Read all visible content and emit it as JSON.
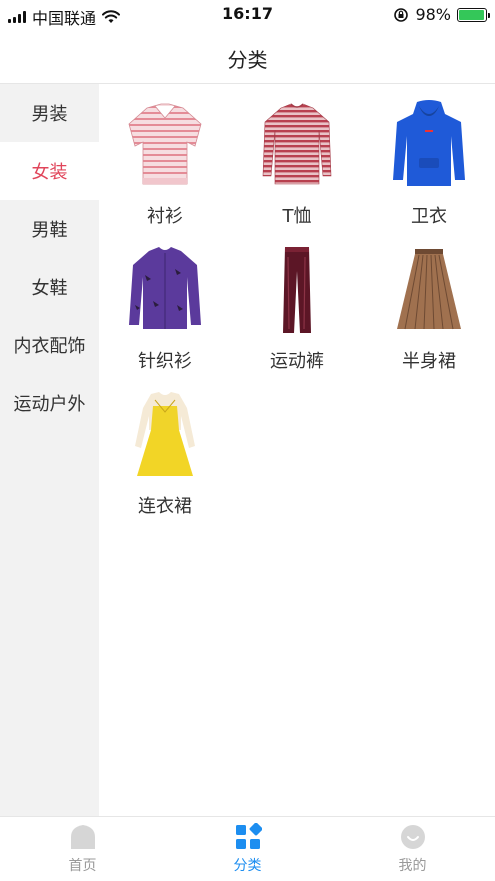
{
  "status_bar": {
    "carrier": "中国联通",
    "time": "16:17",
    "battery_percent": "98%",
    "battery_level": 0.98
  },
  "nav": {
    "title": "分类"
  },
  "sidebar": {
    "items": [
      {
        "label": "男装",
        "active": false
      },
      {
        "label": "女装",
        "active": true
      },
      {
        "label": "男鞋",
        "active": false
      },
      {
        "label": "女鞋",
        "active": false
      },
      {
        "label": "内衣配饰",
        "active": false
      },
      {
        "label": "运动户外",
        "active": false
      }
    ]
  },
  "categories": [
    {
      "label": "衬衫",
      "icon": "striped-blouse-image"
    },
    {
      "label": "T恤",
      "icon": "striped-tshirt-image"
    },
    {
      "label": "卫衣",
      "icon": "blue-hoodie-image"
    },
    {
      "label": "针织衫",
      "icon": "purple-knit-sweater-image"
    },
    {
      "label": "运动裤",
      "icon": "burgundy-velvet-pants-image"
    },
    {
      "label": "半身裙",
      "icon": "bronze-pleated-skirt-image"
    },
    {
      "label": "连衣裙",
      "icon": "yellow-dress-image"
    }
  ],
  "tab_bar": {
    "tabs": [
      {
        "label": "首页",
        "icon": "home-icon",
        "active": false
      },
      {
        "label": "分类",
        "icon": "category-grid-icon",
        "active": true
      },
      {
        "label": "我的",
        "icon": "profile-icon",
        "active": false
      }
    ]
  },
  "colors": {
    "accent_active_side": "#e0455a",
    "tab_active": "#1d8ef0",
    "tab_inactive": "#999999",
    "sidebar_bg": "#f2f2f2"
  }
}
